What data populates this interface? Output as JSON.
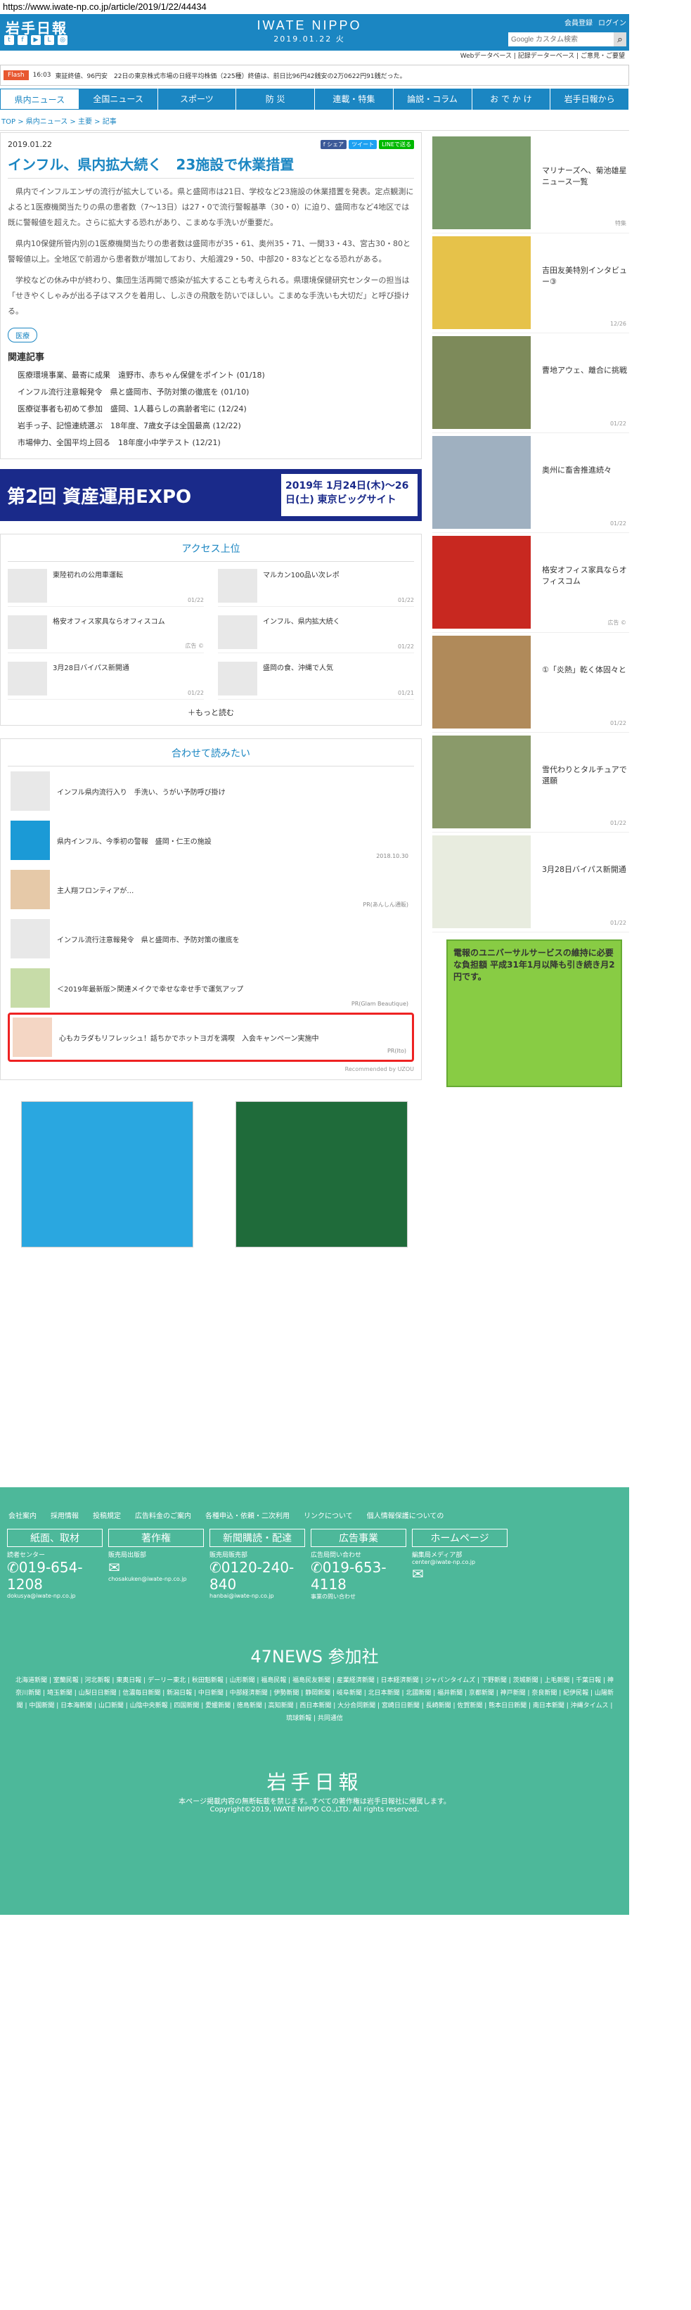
{
  "url": "https://www.iwate-np.co.jp/article/2019/1/22/44434",
  "header": {
    "logo": "岩手日報",
    "brand": "IWATE NIPPO",
    "date": "2019.01.22 火",
    "links": [
      "会員登録",
      "ログイン"
    ],
    "search_placeholder": "Google カスタム検索",
    "sublinks": "Webデータベース | 記録データーベース | ご意見・ご要望"
  },
  "ticker": {
    "label": "Flash",
    "time": "16:03",
    "text": "東証終値、96円安　22日の東京株式市場の日経平均株価（225種）終値は、前日比96円42銭安の2万0622円91銭だった。"
  },
  "nav": [
    "県内ニュース",
    "全国ニュース",
    "スポーツ",
    "防 災",
    "連載・特集",
    "論説・コラム",
    "お で か け",
    "岩手日報から"
  ],
  "breadcrumb": "TOP > 県内ニュース > 主要 > 記事",
  "article": {
    "date": "2019.01.22",
    "share": [
      "f シェア",
      "ツイート",
      "LINEで送る"
    ],
    "title": "インフル、県内拡大続く　23施設で休業措置",
    "p1": "県内でインフルエンザの流行が拡大している。県と盛岡市は21日、学校など23施設の休業措置を発表。定点観測によると1医療機関当たりの県の患者数（7～13日）は27・0で流行警報基準（30・0）に迫り、盛岡市など4地区では既に警報値を超えた。さらに拡大する恐れがあり、こまめな手洗いが重要だ。",
    "p2": "県内10保健所管内別の1医療機関当たりの患者数は盛岡市が35・61、奥州35・71、一関33・43、宮古30・80と警報値以上。全地区で前週から患者数が増加しており、大船渡29・50、中部20・83などとなる恐れがある。",
    "p3": "学校などの休み中が終わり、集団生活再開で感染が拡大することも考えられる。県環境保健研究センターの担当は「せきやくしゃみが出る子はマスクを着用し、しぶきの飛散を防いでほしい。こまめな手洗いも大切だ」と呼び掛ける。",
    "tag": "医療",
    "related_title": "関連記事",
    "related": [
      "医療環境事業、最寄に成果　遠野市、赤ちゃん保健をポイント (01/18)",
      "インフル流行注意報発令　県と盛岡市、予防対策の徹底を (01/10)",
      "医療従事者も初めて参加　盛岡、1人暮らしの高齢者宅に (12/24)",
      "岩手っ子、記憶連続選ぶ　18年度、7歳女子は全国最高 (12/22)",
      "市場伸力、全国平均上回る　18年度小中学テスト (12/21)"
    ]
  },
  "expo": {
    "left": "第2回 資産運用EXPO",
    "right": "2019年 1月24日(木)～26日(土) 東京ビッグサイト"
  },
  "ranking": {
    "title": "アクセス上位",
    "items": [
      {
        "t": "東陸初れの公用車運転",
        "d": "01/22"
      },
      {
        "t": "マルカン100品い次レポ",
        "d": "01/22"
      },
      {
        "t": "格安オフィス家具ならオフィスコム",
        "d": "広告 ©"
      },
      {
        "t": "インフル、県内拡大続く",
        "d": "01/22"
      },
      {
        "t": "3月28日バイパス新開通",
        "d": "01/22"
      },
      {
        "t": "盛岡の食、沖縄で人気",
        "d": "01/21"
      }
    ],
    "more": "もっと読む"
  },
  "recommend": {
    "title": "合わせて読みたい",
    "items": [
      {
        "t": "インフル県内流行入り　手洗い、うがい予防呼び掛け",
        "d": ""
      },
      {
        "t": "県内インフル、今季初の警報　盛岡・仁王の施設",
        "d": "2018.10.30"
      },
      {
        "t": "主人翔フロンティアが…",
        "d": "PR(あんしん通販)"
      },
      {
        "t": "インフル流行注意報発令　県と盛岡市、予防対策の徹底を",
        "d": ""
      },
      {
        "t": "＜2019年最新版＞関連メイクで幸せな幸せ手で運気アップ",
        "d": "PR(Glam Beautique)"
      },
      {
        "t": "心もカラダもリフレッシュ！話ちかでホットヨガを満喫　入会キャンペーン実施中",
        "d": "PR(Ito)"
      }
    ],
    "credit": "Recommended by UZOU"
  },
  "sidebar": [
    {
      "t": "マリナーズへ、菊池雄星ニュース一覧",
      "d": "特集"
    },
    {
      "t": "吉田友美特別インタビュー③",
      "d": "12/26"
    },
    {
      "t": "曹地アウェ、離合に挑戦",
      "d": "01/22"
    },
    {
      "t": "奥州に畜舎推進続々",
      "d": "01/22"
    },
    {
      "t": "格安オフィス家具ならオフィスコム",
      "d": "広告 ©"
    },
    {
      "t": "①「炎熱」乾く体固々と",
      "d": "01/22"
    },
    {
      "t": "雪代わりとタルチュアで選願",
      "d": "01/22"
    },
    {
      "t": "3月28日バイパス新開通",
      "d": "01/22"
    }
  ],
  "sidead": "電報のユニバーサルサービスの維持に必要な負担額 平成31年1月以降も引き続き月2円です。",
  "footer": {
    "links": [
      "会社案内",
      "採用情報",
      "投稿規定",
      "広告料金のご案内",
      "各種申込・依頼・二次利用",
      "リンクについて",
      "個人情報保護についての"
    ],
    "cols": [
      {
        "h": "紙面、取材",
        "lb": "読者センター",
        "ph": "019-654-1208",
        "s": "dokusya@iwate-np.co.jp"
      },
      {
        "h": "著作権",
        "lb": "販売局出版部",
        "ph": "",
        "s": "chosakuken@iwate-np.co.jp"
      },
      {
        "h": "新聞購読・配達",
        "lb": "販売局販売部",
        "ph": "0120-240-840",
        "s": "hanbai@iwate-np.co.jp"
      },
      {
        "h": "広告事業",
        "lb": "広告局問い合わせ",
        "ph": "019-653-4118",
        "s": "事業の問い合わせ"
      },
      {
        "h": "ホームページ",
        "lb": "編集局メディア部",
        "ph": "",
        "s": "center@iwate-np.co.jp"
      }
    ],
    "n47": "47NEWS 参加社",
    "papers": "北海道新聞 | 室蘭民報 | 河北新報 | 東奥日報 | デーリー東北 | 秋田魁新報 | 山形新聞 | 福島民報 | 福島民友新聞 | 産業経済新聞 | 日本経済新聞 | ジャパンタイムズ | 下野新聞 | 茨城新聞 | 上毛新聞 | 千葉日報 | 神奈川新聞 | 埼玉新聞 | 山梨日日新聞 | 信濃毎日新聞 | 新潟日報 | 中日新聞 | 中部経済新聞 | 伊勢新聞 | 静岡新聞 | 岐阜新聞 | 北日本新聞 | 北國新聞 | 福井新聞 | 京都新聞 | 神戸新聞 | 奈良新聞 | 紀伊民報 | 山陽新聞 | 中国新聞 | 日本海新聞 | 山口新聞 | 山陰中央新報 | 四国新聞 | 愛媛新聞 | 徳島新聞 | 高知新聞 | 西日本新聞 | 大分合同新聞 | 宮崎日日新聞 | 長崎新聞 | 佐賀新聞 | 熊本日日新聞 | 南日本新聞 | 沖縄タイムス | 琉球新報 | 共同通信",
    "flogo": "岩手日報",
    "notice": "本ページ掲載内容の無断転載を禁じます。すべての著作権は岩手日報社に帰属します。",
    "copyright": "Copyright©2019, IWATE NIPPO CO.,LTD. All rights reserved."
  }
}
